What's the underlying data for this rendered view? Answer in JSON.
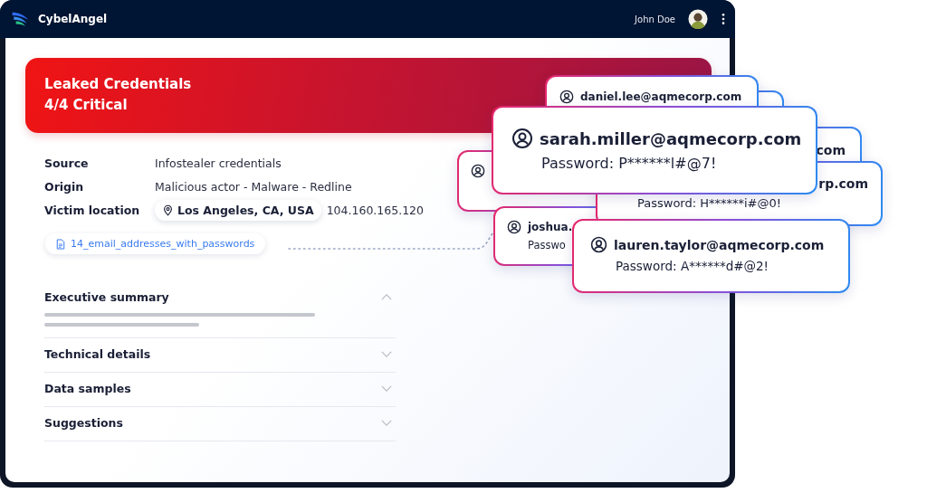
{
  "header": {
    "brand": "CybelAngel",
    "user": "John Doe"
  },
  "alert": {
    "title": "Leaked Credentials",
    "severity": "4/4 Critical"
  },
  "details": [
    {
      "label": "Source",
      "value": "Infostealer credentials"
    },
    {
      "label": "Origin",
      "value": "Malicious actor - Malware - Redline"
    },
    {
      "label": "Victim location",
      "location": "Los Angeles, CA, USA",
      "value": "104.160.165.120"
    }
  ],
  "file": "14_email_addresses_with_passwords",
  "sections": [
    {
      "title": "Executive summary",
      "expanded": true
    },
    {
      "title": "Technical details",
      "expanded": false
    },
    {
      "title": "Data samples",
      "expanded": false
    },
    {
      "title": "Suggestions",
      "expanded": false
    }
  ],
  "credential_cards": [
    {
      "kind": "full",
      "email": "daniel.lee@aqmecorp.com"
    },
    {
      "kind": "blank"
    },
    {
      "kind": "full",
      "email": "sarah.miller@aqmecorp.com",
      "password": "Password: P******l#@7!"
    },
    {
      "kind": "text",
      "email": "com"
    },
    {
      "kind": "icon"
    },
    {
      "kind": "text",
      "email": "rp.com",
      "password": "Password: H******i#@0!"
    },
    {
      "kind": "full",
      "email": "joshua.",
      "password": "Passwo"
    },
    {
      "kind": "full",
      "email": "lauren.taylor@aqmecorp.com",
      "password": "Password: A******d#@2!"
    }
  ]
}
